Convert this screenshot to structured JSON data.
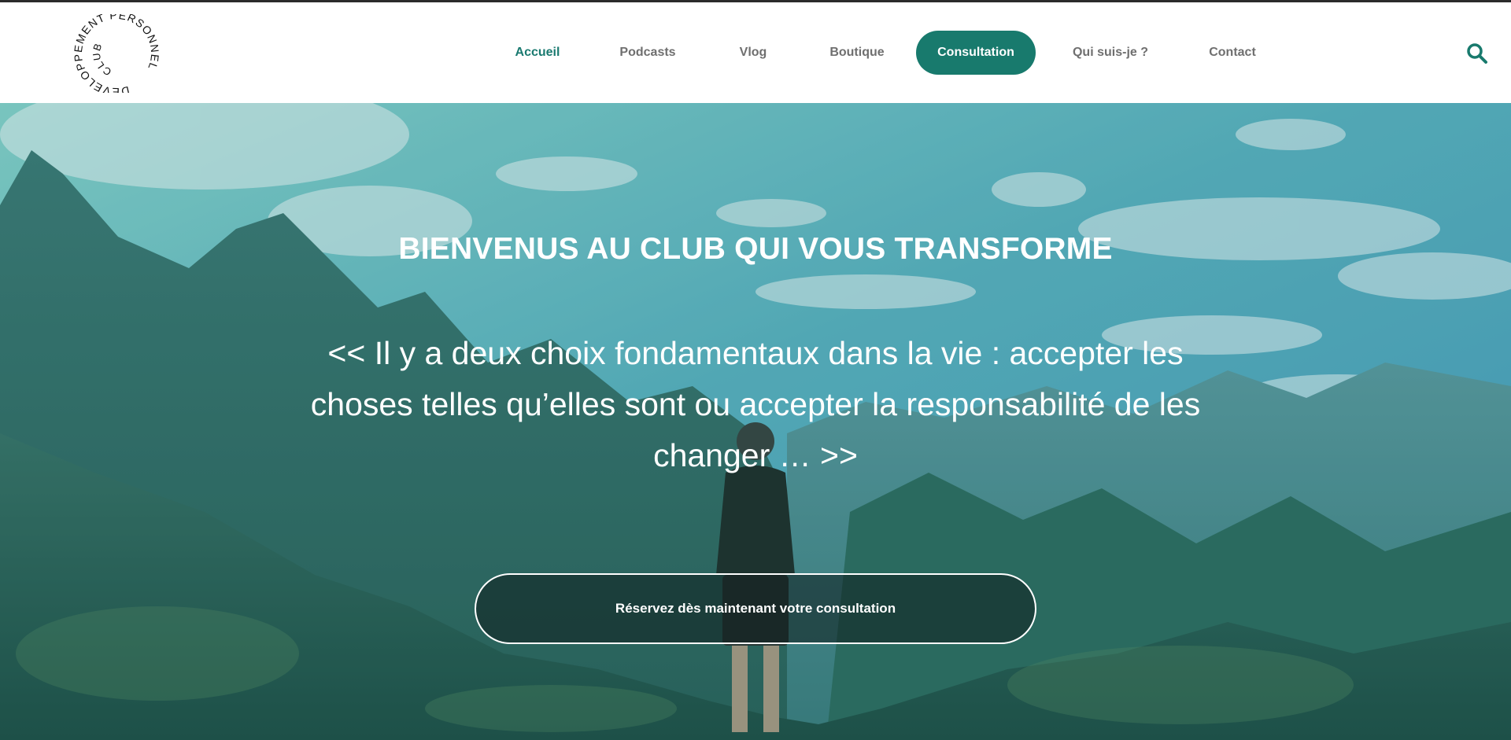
{
  "logo": {
    "line1": "DÉVELOPPEMENT PERSONNEL",
    "line2": "CLUB"
  },
  "nav": {
    "items": [
      {
        "label": "Accueil"
      },
      {
        "label": "Podcasts"
      },
      {
        "label": "Vlog"
      },
      {
        "label": "Boutique"
      },
      {
        "label": "Consultation"
      },
      {
        "label": "Qui suis-je ?"
      },
      {
        "label": "Contact"
      }
    ],
    "active_index": 0,
    "cta_index": 4
  },
  "search": {
    "icon": "search-icon"
  },
  "hero": {
    "title": "BIENVENUS AU CLUB QUI VOUS TRANSFORME",
    "quote": "<< Il y a deux choix fondamentaux dans la vie : accepter les choses telles qu’elles sont ou accepter la responsabilité de les changer … >>",
    "button_label": "Réservez dès maintenant votre consultation"
  },
  "colors": {
    "accent": "#187a6d",
    "nav_text": "#6f6f6f",
    "active_text": "#1a7a70"
  }
}
